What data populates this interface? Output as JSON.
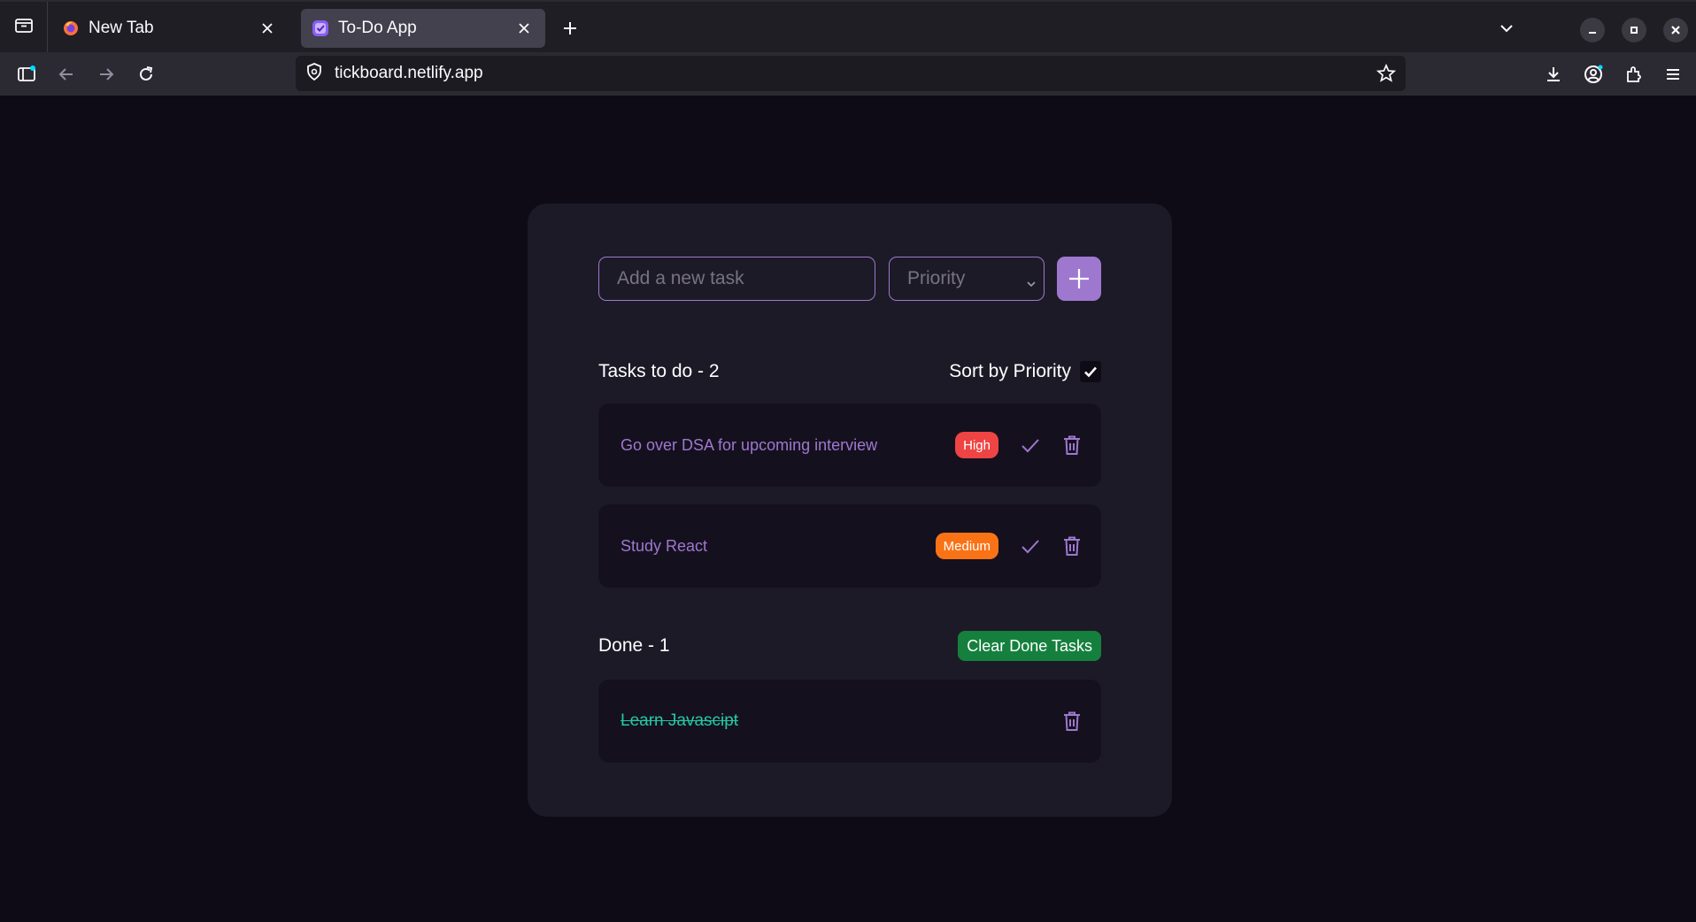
{
  "browser": {
    "tabs": [
      {
        "title": "New Tab",
        "active": false
      },
      {
        "title": "To-Do App",
        "active": true
      }
    ],
    "url": "tickboard.netlify.app"
  },
  "app": {
    "input_placeholder": "Add a new task",
    "priority_placeholder": "Priority",
    "todo_header": "Tasks to do - 2",
    "sort_label": "Sort by Priority",
    "sort_checked": true,
    "todo_tasks": [
      {
        "text": "Go over DSA for upcoming interview",
        "priority": "High"
      },
      {
        "text": "Study React",
        "priority": "Medium"
      }
    ],
    "done_header": "Done - 1",
    "clear_button": "Clear Done Tasks",
    "done_tasks": [
      {
        "text": "Learn Javascipt"
      }
    ]
  },
  "colors": {
    "accent": "#9e78cf",
    "high": "#ef4444",
    "medium": "#f97316",
    "done_text": "#22c9a5",
    "clear_button": "#15803d"
  }
}
